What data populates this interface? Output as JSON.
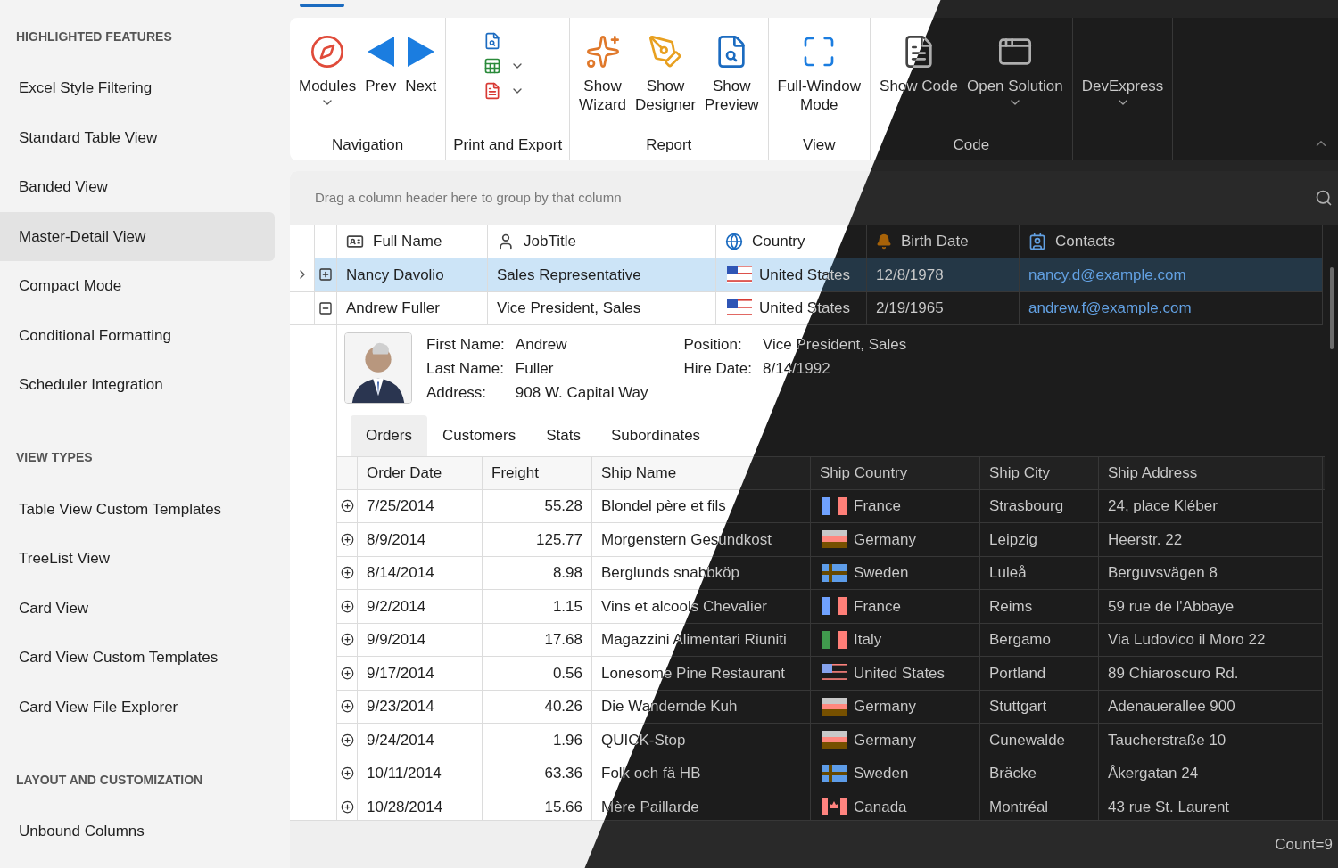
{
  "sidebar": {
    "sections": [
      {
        "header": "HIGHLIGHTED FEATURES",
        "items": [
          {
            "label": "Excel Style Filtering",
            "selected": false
          },
          {
            "label": "Standard Table View",
            "selected": false
          },
          {
            "label": "Banded View",
            "selected": false
          },
          {
            "label": "Master-Detail View",
            "selected": true
          },
          {
            "label": "Compact Mode",
            "selected": false
          },
          {
            "label": "Conditional Formatting",
            "selected": false
          },
          {
            "label": "Scheduler Integration",
            "selected": false
          }
        ]
      },
      {
        "header": "VIEW TYPES",
        "items": [
          {
            "label": "Table View Custom Templates",
            "selected": false
          },
          {
            "label": "TreeList View",
            "selected": false
          },
          {
            "label": "Card View",
            "selected": false
          },
          {
            "label": "Card View Custom Templates",
            "selected": false
          },
          {
            "label": "Card View File Explorer",
            "selected": false
          }
        ]
      },
      {
        "header": "LAYOUT AND CUSTOMIZATION",
        "items": [
          {
            "label": "Unbound Columns",
            "selected": false
          }
        ]
      }
    ]
  },
  "ribbon": {
    "groups": [
      {
        "label": "Navigation",
        "kind": "large",
        "buttons": [
          {
            "lines": [
              "Modules"
            ],
            "dropdown": true
          },
          {
            "lines": [
              "Prev"
            ],
            "dropdown": false
          },
          {
            "lines": [
              "Next"
            ],
            "dropdown": false
          }
        ]
      },
      {
        "label": "Print and Export",
        "kind": "small",
        "buttons": [
          {
            "dropdown": false
          },
          {
            "dropdown": true
          },
          {
            "dropdown": true
          }
        ]
      },
      {
        "label": "Report",
        "kind": "large",
        "buttons": [
          {
            "lines": [
              "Show",
              "Wizard"
            ],
            "dropdown": false
          },
          {
            "lines": [
              "Show",
              "Designer"
            ],
            "dropdown": false
          },
          {
            "lines": [
              "Show",
              "Preview"
            ],
            "dropdown": false
          }
        ]
      },
      {
        "label": "View",
        "kind": "large",
        "buttons": [
          {
            "lines": [
              "Full-Window",
              "Mode"
            ],
            "dropdown": false
          }
        ]
      },
      {
        "label": "Code",
        "kind": "large",
        "buttons": [
          {
            "lines": [
              "Show Code"
            ],
            "dropdown": false
          },
          {
            "lines": [
              "Open Solution"
            ],
            "dropdown": true
          }
        ]
      },
      {
        "kind": "large",
        "buttons": [
          {
            "lines": [
              "DevExpress"
            ],
            "dropdown": true
          }
        ]
      }
    ]
  },
  "grid": {
    "group_panel": "Drag a column header here to group by that column",
    "columns": [
      "Full Name",
      "JobTitle",
      "Country",
      "Birth Date",
      "Contacts"
    ],
    "rows": [
      {
        "focused": true,
        "expanded": false,
        "selected": true,
        "full_name": "Nancy Davolio",
        "job_title": "Sales Representative",
        "country": "United States",
        "birth_date": "12/8/1978",
        "contact": "nancy.d@example.com"
      },
      {
        "focused": false,
        "expanded": true,
        "selected": false,
        "full_name": "Andrew Fuller",
        "job_title": "Vice President, Sales",
        "country": "United States",
        "birth_date": "2/19/1965",
        "contact": "andrew.f@example.com"
      }
    ],
    "detail": {
      "fields_left": [
        {
          "label": "First Name:",
          "value": "Andrew"
        },
        {
          "label": "Last Name:",
          "value": "Fuller"
        },
        {
          "label": "Address:",
          "value": "908 W. Capital Way"
        }
      ],
      "fields_right": [
        {
          "label": "Position:",
          "value": "Vice President, Sales"
        },
        {
          "label": "Hire Date:",
          "value": "8/14/1992"
        }
      ],
      "tabs": [
        {
          "label": "Orders",
          "selected": true
        },
        {
          "label": "Customers",
          "selected": false
        },
        {
          "label": "Stats",
          "selected": false
        },
        {
          "label": "Subordinates",
          "selected": false
        }
      ],
      "columns": [
        "Order Date",
        "Freight",
        "Ship Name",
        "Ship Country",
        "Ship City",
        "Ship Address"
      ],
      "rows": [
        [
          "7/25/2014",
          "55.28",
          "Blondel père et fils",
          "France",
          "Strasbourg",
          "24, place Kléber"
        ],
        [
          "8/9/2014",
          "125.77",
          "Morgenstern Gesundkost",
          "Germany",
          "Leipzig",
          "Heerstr. 22"
        ],
        [
          "8/14/2014",
          "8.98",
          "Berglunds snabbköp",
          "Sweden",
          "Luleå",
          "Berguvsvägen  8"
        ],
        [
          "9/2/2014",
          "1.15",
          "Vins et alcools Chevalier",
          "France",
          "Reims",
          "59 rue de l'Abbaye"
        ],
        [
          "9/9/2014",
          "17.68",
          "Magazzini Alimentari Riuniti",
          "Italy",
          "Bergamo",
          "Via Ludovico il Moro 22"
        ],
        [
          "9/17/2014",
          "0.56",
          "Lonesome Pine Restaurant",
          "United States",
          "Portland",
          "89 Chiaroscuro Rd."
        ],
        [
          "9/23/2014",
          "40.26",
          "Die Wandernde Kuh",
          "Germany",
          "Stuttgart",
          "Adenauerallee 900"
        ],
        [
          "9/24/2014",
          "1.96",
          "QUICK-Stop",
          "Germany",
          "Cunewalde",
          "Taucherstraße 10"
        ],
        [
          "10/11/2014",
          "63.36",
          "Folk och fä HB",
          "Sweden",
          "Bräcke",
          "Åkergatan 24"
        ],
        [
          "10/28/2014",
          "15.66",
          "Mère Paillarde",
          "Canada",
          "Montréal",
          "43 rue St. Laurent"
        ]
      ]
    },
    "footer": "Count=9"
  }
}
